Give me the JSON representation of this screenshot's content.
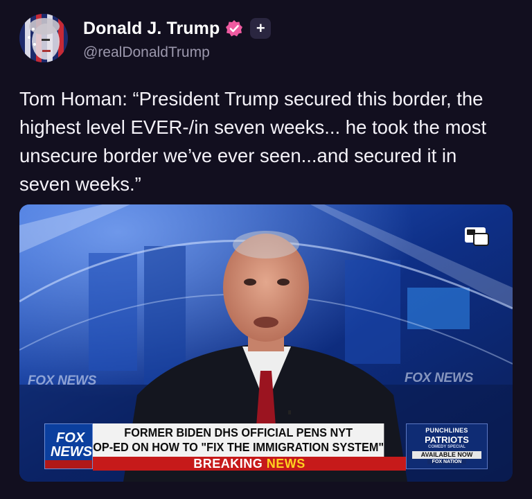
{
  "post": {
    "author": {
      "display_name": "Donald J. Trump",
      "handle": "@realDonaldTrump",
      "verified_icon": "verified-badge-icon",
      "follow_symbol": "+"
    },
    "text": "Tom Homan: “President Trump secured this border, the highest level EVER-/in seven weeks... he took the most unsecure border we’ve ever seen...and secured it in seven weeks.”"
  },
  "video": {
    "pip_icon": "picture-in-picture-icon",
    "watermark_left": "FOX NEWS",
    "watermark_right": "FOX NEWS",
    "logo_line1": "FOX",
    "logo_line2": "NEWS",
    "headline_line1": "FORMER BIDEN DHS OFFICIAL PENS NYT",
    "headline_line2": "OP-ED ON HOW TO \"FIX THE IMMIGRATION SYSTEM\"",
    "banner_part1": "BREAKING",
    "banner_part2": "NEWS",
    "promo": {
      "line1": "PUNCHLINES",
      "line2": "PATRIOTS",
      "line3": "COMEDY SPECIAL",
      "line4": "AVAILABLE NOW",
      "line5": "FOX NATION"
    }
  },
  "colors": {
    "background": "#120f1f",
    "verified_badge": "#ee5aa0",
    "breaking_red": "#c61a1a",
    "news_yellow": "#ffd21f"
  }
}
